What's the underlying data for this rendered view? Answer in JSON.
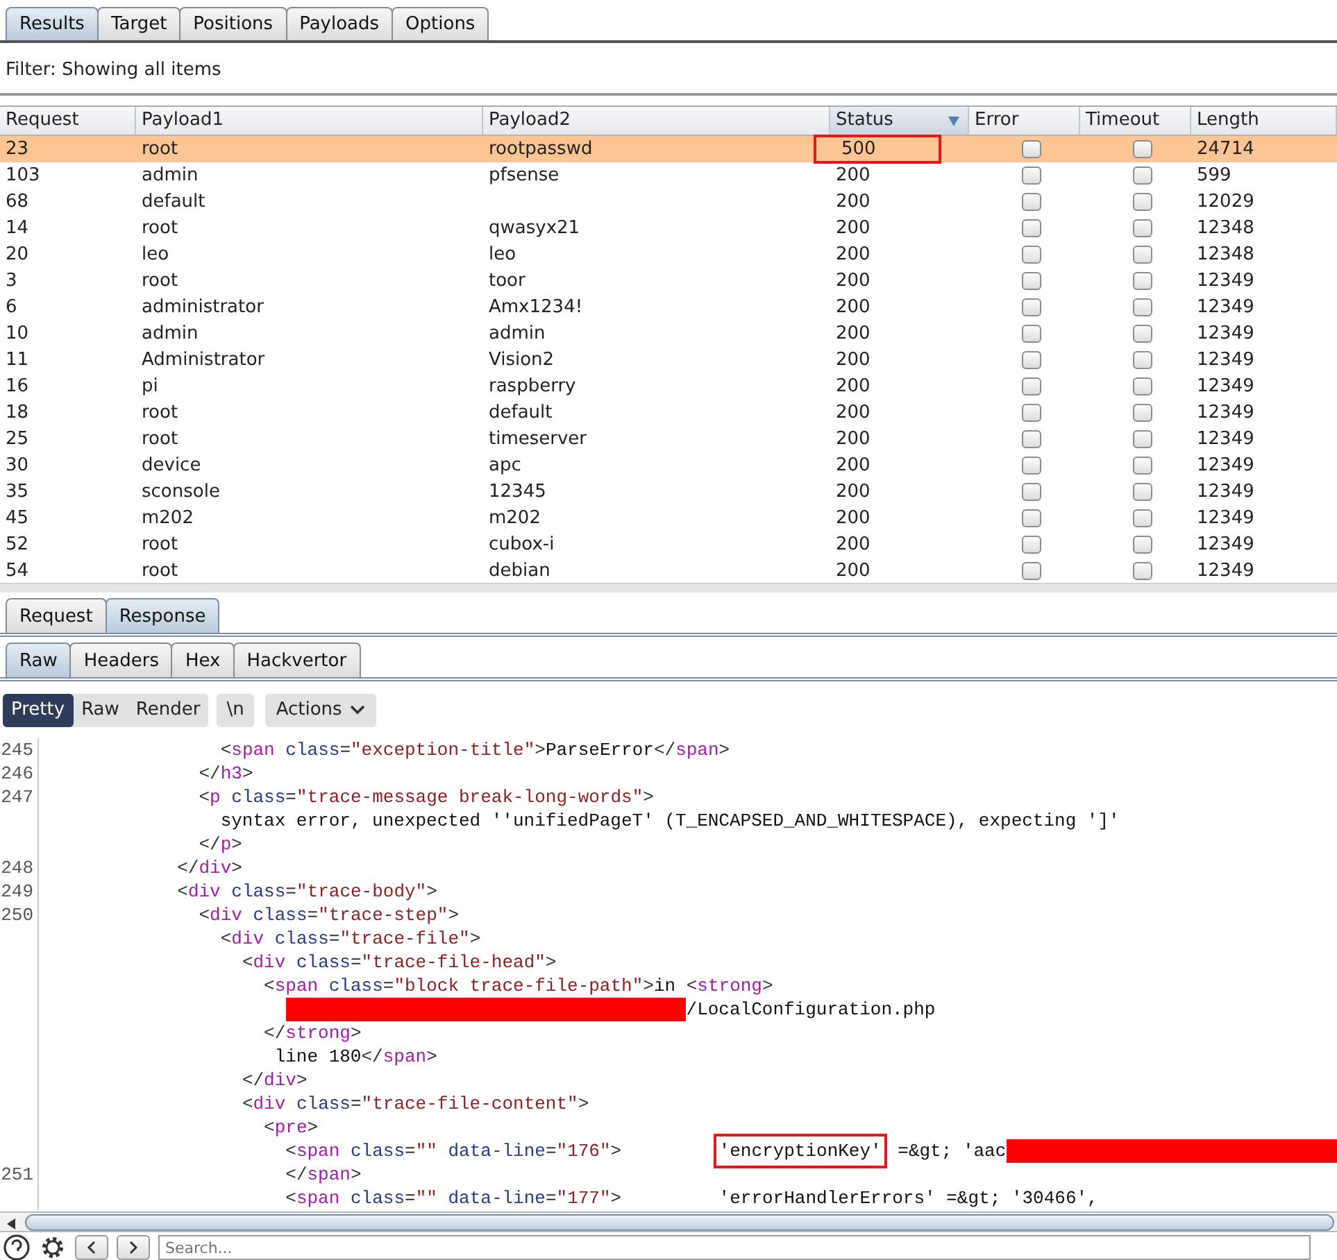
{
  "top_tabs": [
    {
      "label": "Results",
      "selected": true
    },
    {
      "label": "Target",
      "selected": false
    },
    {
      "label": "Positions",
      "selected": false
    },
    {
      "label": "Payloads",
      "selected": false
    },
    {
      "label": "Options",
      "selected": false
    }
  ],
  "filter": "Filter: Showing all items",
  "results": {
    "columns": [
      {
        "label": "Request",
        "sorted": false
      },
      {
        "label": "Payload1",
        "sorted": false
      },
      {
        "label": "Payload2",
        "sorted": false
      },
      {
        "label": "Status",
        "sorted": true
      },
      {
        "label": "Error",
        "sorted": false
      },
      {
        "label": "Timeout",
        "sorted": false
      },
      {
        "label": "Length",
        "sorted": false
      }
    ],
    "rows": [
      {
        "request": "23",
        "payload1": "root",
        "payload2": "rootpasswd",
        "status": "500",
        "error": false,
        "timeout": false,
        "length": "24714",
        "selected": true,
        "status_flagged": true
      },
      {
        "request": "103",
        "payload1": "admin",
        "payload2": "pfsense",
        "status": "200",
        "error": false,
        "timeout": false,
        "length": "599",
        "selected": false,
        "status_flagged": false
      },
      {
        "request": "68",
        "payload1": "default",
        "status": "200",
        "error": false,
        "timeout": false,
        "length": "12029",
        "selected": false,
        "status_flagged": false
      },
      {
        "request": "14",
        "payload1": "root",
        "payload2": "qwasyx21",
        "status": "200",
        "error": false,
        "timeout": false,
        "length": "12348",
        "selected": false,
        "status_flagged": false
      },
      {
        "request": "20",
        "payload1": "leo",
        "payload2": "leo",
        "status": "200",
        "error": false,
        "timeout": false,
        "length": "12348",
        "selected": false,
        "status_flagged": false
      },
      {
        "request": "3",
        "payload1": "root",
        "payload2": "toor",
        "status": "200",
        "error": false,
        "timeout": false,
        "length": "12349",
        "selected": false,
        "status_flagged": false
      },
      {
        "request": "6",
        "payload1": "administrator",
        "payload2": "Amx1234!",
        "status": "200",
        "error": false,
        "timeout": false,
        "length": "12349",
        "selected": false,
        "status_flagged": false
      },
      {
        "request": "10",
        "payload1": "admin",
        "payload2": "admin",
        "status": "200",
        "error": false,
        "timeout": false,
        "length": "12349",
        "selected": false,
        "status_flagged": false
      },
      {
        "request": "11",
        "payload1": "Administrator",
        "payload2": "Vision2",
        "status": "200",
        "error": false,
        "timeout": false,
        "length": "12349",
        "selected": false,
        "status_flagged": false
      },
      {
        "request": "16",
        "payload1": "pi",
        "payload2": "raspberry",
        "status": "200",
        "error": false,
        "timeout": false,
        "length": "12349",
        "selected": false,
        "status_flagged": false
      },
      {
        "request": "18",
        "payload1": "root",
        "payload2": "default",
        "status": "200",
        "error": false,
        "timeout": false,
        "length": "12349",
        "selected": false,
        "status_flagged": false
      },
      {
        "request": "25",
        "payload1": "root",
        "payload2": "timeserver",
        "status": "200",
        "error": false,
        "timeout": false,
        "length": "12349",
        "selected": false,
        "status_flagged": false
      },
      {
        "request": "30",
        "payload1": "device",
        "payload2": "apc",
        "status": "200",
        "error": false,
        "timeout": false,
        "length": "12349",
        "selected": false,
        "status_flagged": false
      },
      {
        "request": "35",
        "payload1": "sconsole",
        "payload2": "12345",
        "status": "200",
        "error": false,
        "timeout": false,
        "length": "12349",
        "selected": false,
        "status_flagged": false
      },
      {
        "request": "45",
        "payload1": "m202",
        "payload2": "m202",
        "status": "200",
        "error": false,
        "timeout": false,
        "length": "12349",
        "selected": false,
        "status_flagged": false
      },
      {
        "request": "52",
        "payload1": "root",
        "payload2": "cubox-i",
        "status": "200",
        "error": false,
        "timeout": false,
        "length": "12349",
        "selected": false,
        "status_flagged": false
      },
      {
        "request": "54",
        "payload1": "root",
        "payload2": "debian",
        "status": "200",
        "error": false,
        "timeout": false,
        "length": "12349",
        "selected": false,
        "status_flagged": false
      }
    ]
  },
  "message_tabs": [
    {
      "label": "Request",
      "selected": false
    },
    {
      "label": "Response",
      "selected": true
    }
  ],
  "view_tabs": [
    {
      "label": "Raw",
      "selected": true
    },
    {
      "label": "Headers",
      "selected": false
    },
    {
      "label": "Hex",
      "selected": false
    },
    {
      "label": "Hackvertor",
      "selected": false
    }
  ],
  "toolbar": {
    "modes": [
      {
        "label": "Pretty",
        "selected": true
      },
      {
        "label": "Raw",
        "selected": false
      },
      {
        "label": "Render",
        "selected": false
      }
    ],
    "newline_button": "\\n",
    "actions_button": "Actions"
  },
  "code_lines": [
    {
      "number": "245",
      "parts": [
        {
          "kind": "code",
          "text": "                <span class=\"exception-title\">ParseError</span>"
        }
      ]
    },
    {
      "number": "246",
      "parts": [
        {
          "kind": "code",
          "text": "              </h3>"
        }
      ]
    },
    {
      "number": "247",
      "parts": [
        {
          "kind": "code",
          "text": "              <p class=\"trace-message break-long-words\">"
        }
      ]
    },
    {
      "parts": [
        {
          "kind": "code",
          "text": "                syntax error, unexpected ''unifiedPageT' (T_ENCAPSED_AND_WHITESPACE), expecting ']'"
        }
      ]
    },
    {
      "parts": [
        {
          "kind": "code",
          "text": "              </p>"
        }
      ]
    },
    {
      "number": "248",
      "parts": [
        {
          "kind": "code",
          "text": "            </div>"
        }
      ]
    },
    {
      "number": "249",
      "parts": [
        {
          "kind": "code",
          "text": "            <div class=\"trace-body\">"
        }
      ]
    },
    {
      "number": "250",
      "parts": [
        {
          "kind": "code",
          "text": "              <div class=\"trace-step\">"
        }
      ]
    },
    {
      "parts": [
        {
          "kind": "code",
          "text": "                <div class=\"trace-file\">"
        }
      ]
    },
    {
      "parts": [
        {
          "kind": "code",
          "text": "                  <div class=\"trace-file-head\">"
        }
      ]
    },
    {
      "parts": [
        {
          "kind": "code",
          "text": "                    <span class=\"block trace-file-path\">in <strong>"
        }
      ]
    },
    {
      "parts": [
        {
          "kind": "redaction"
        },
        {
          "kind": "code",
          "text": "/LocalConfiguration.php"
        }
      ]
    },
    {
      "parts": [
        {
          "kind": "code",
          "text": "                    </strong>"
        }
      ]
    },
    {
      "parts": [
        {
          "kind": "code",
          "text": "                     line 180</span>"
        }
      ]
    },
    {
      "parts": [
        {
          "kind": "code",
          "text": "                  </div>"
        }
      ]
    },
    {
      "parts": [
        {
          "kind": "code",
          "text": "                  <div class=\"trace-file-content\">"
        }
      ]
    },
    {
      "parts": [
        {
          "kind": "code",
          "text": "                    <pre>"
        }
      ]
    },
    {
      "parts": [
        {
          "kind": "code",
          "text": "                      <span class=\"\" data-line=\"176\">         "
        },
        {
          "kind": "callout",
          "text": "'encryptionKey'"
        },
        {
          "kind": "code",
          "text": " =&gt; 'aac"
        },
        {
          "kind": "redaction"
        }
      ]
    },
    {
      "number": "251",
      "parts": [
        {
          "kind": "code",
          "text": "                      </span>"
        }
      ]
    },
    {
      "parts": [
        {
          "kind": "code",
          "text": "                      <span class=\"\" data-line=\"177\">         'errorHandlerErrors' =&gt; '30466',"
        }
      ]
    }
  ],
  "search": {
    "placeholder": "Search..."
  }
}
